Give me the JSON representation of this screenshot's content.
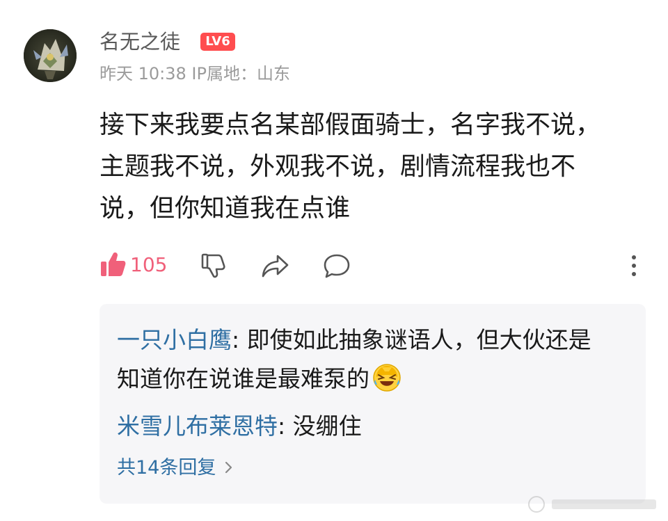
{
  "post": {
    "author": "名无之徒",
    "level_badge": "LV6",
    "meta": "昨天 10:38 IP属地：山东",
    "body_lines": [
      "接下来我要点名某部假面骑士，名字我不说，",
      "主题我不说，外观我不说，剧情流程我也不",
      "说，但你知道我在点谁"
    ]
  },
  "actions": {
    "like_count": "105",
    "like_icon": "thumbs-up-icon",
    "dislike_icon": "thumbs-down-icon",
    "share_icon": "share-icon",
    "comment_icon": "comment-icon",
    "more_icon": "more-vertical-icon"
  },
  "replies": [
    {
      "author": "一只小白鹰",
      "separator": ": ",
      "lines": [
        "即使如此抽象谜语人，但大伙还是",
        "知道你在说谁是最难泵的"
      ],
      "emoji": "laughing-crying-emoji"
    },
    {
      "author": "米雪儿布莱恩特",
      "separator": ": ",
      "lines": [
        "没绷住"
      ]
    }
  ],
  "more_replies": "共14条回复",
  "colors": {
    "like_pink": "#f0607a",
    "reply_author_blue": "#2f6fa3",
    "level_badge_red": "#ff4d4f",
    "meta_gray": "#9b9b9b"
  }
}
